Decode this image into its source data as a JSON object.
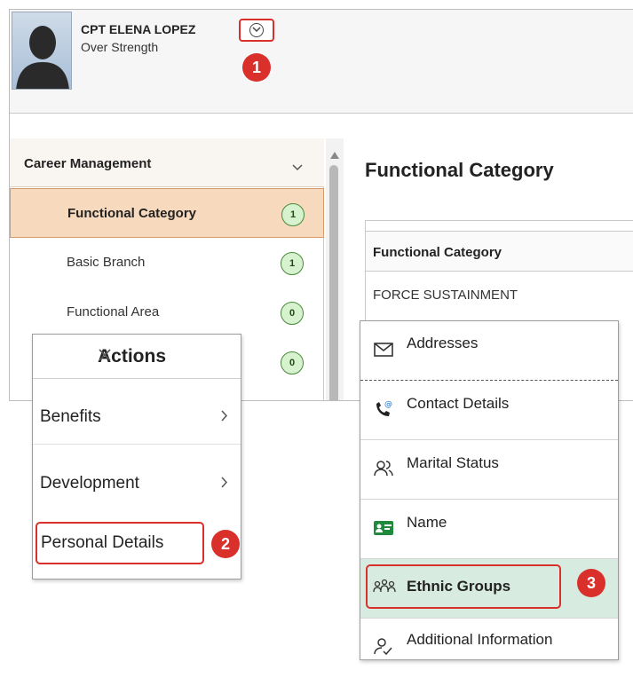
{
  "header": {
    "name": "CPT ELENA LOPEZ",
    "status": "Over Strength"
  },
  "callouts": [
    "1",
    "2",
    "3"
  ],
  "nav": {
    "section": "Career Management",
    "items": [
      {
        "label": "Functional Category",
        "count": "1",
        "active": true
      },
      {
        "label": "Basic Branch",
        "count": "1"
      },
      {
        "label": "Functional Area",
        "count": "0"
      },
      {
        "label": "",
        "count": "0"
      }
    ]
  },
  "content": {
    "title": "Functional Category",
    "column_header": "Functional Category",
    "row_value": "FORCE SUSTAINMENT"
  },
  "actions": {
    "title": "Actions",
    "items": [
      "Benefits",
      "Development",
      "Personal Details"
    ]
  },
  "personal_menu": {
    "items": [
      "Addresses",
      "Contact Details",
      "Marital Status",
      "Name",
      "Ethnic Groups",
      "Additional Information"
    ]
  },
  "colors": {
    "callout": "#d9302b",
    "nav_active": "#f7d9bd",
    "count_badge": "#d7f2cf",
    "menu_highlight": "#d8ebe0",
    "name_icon": "#1f8a3c"
  }
}
